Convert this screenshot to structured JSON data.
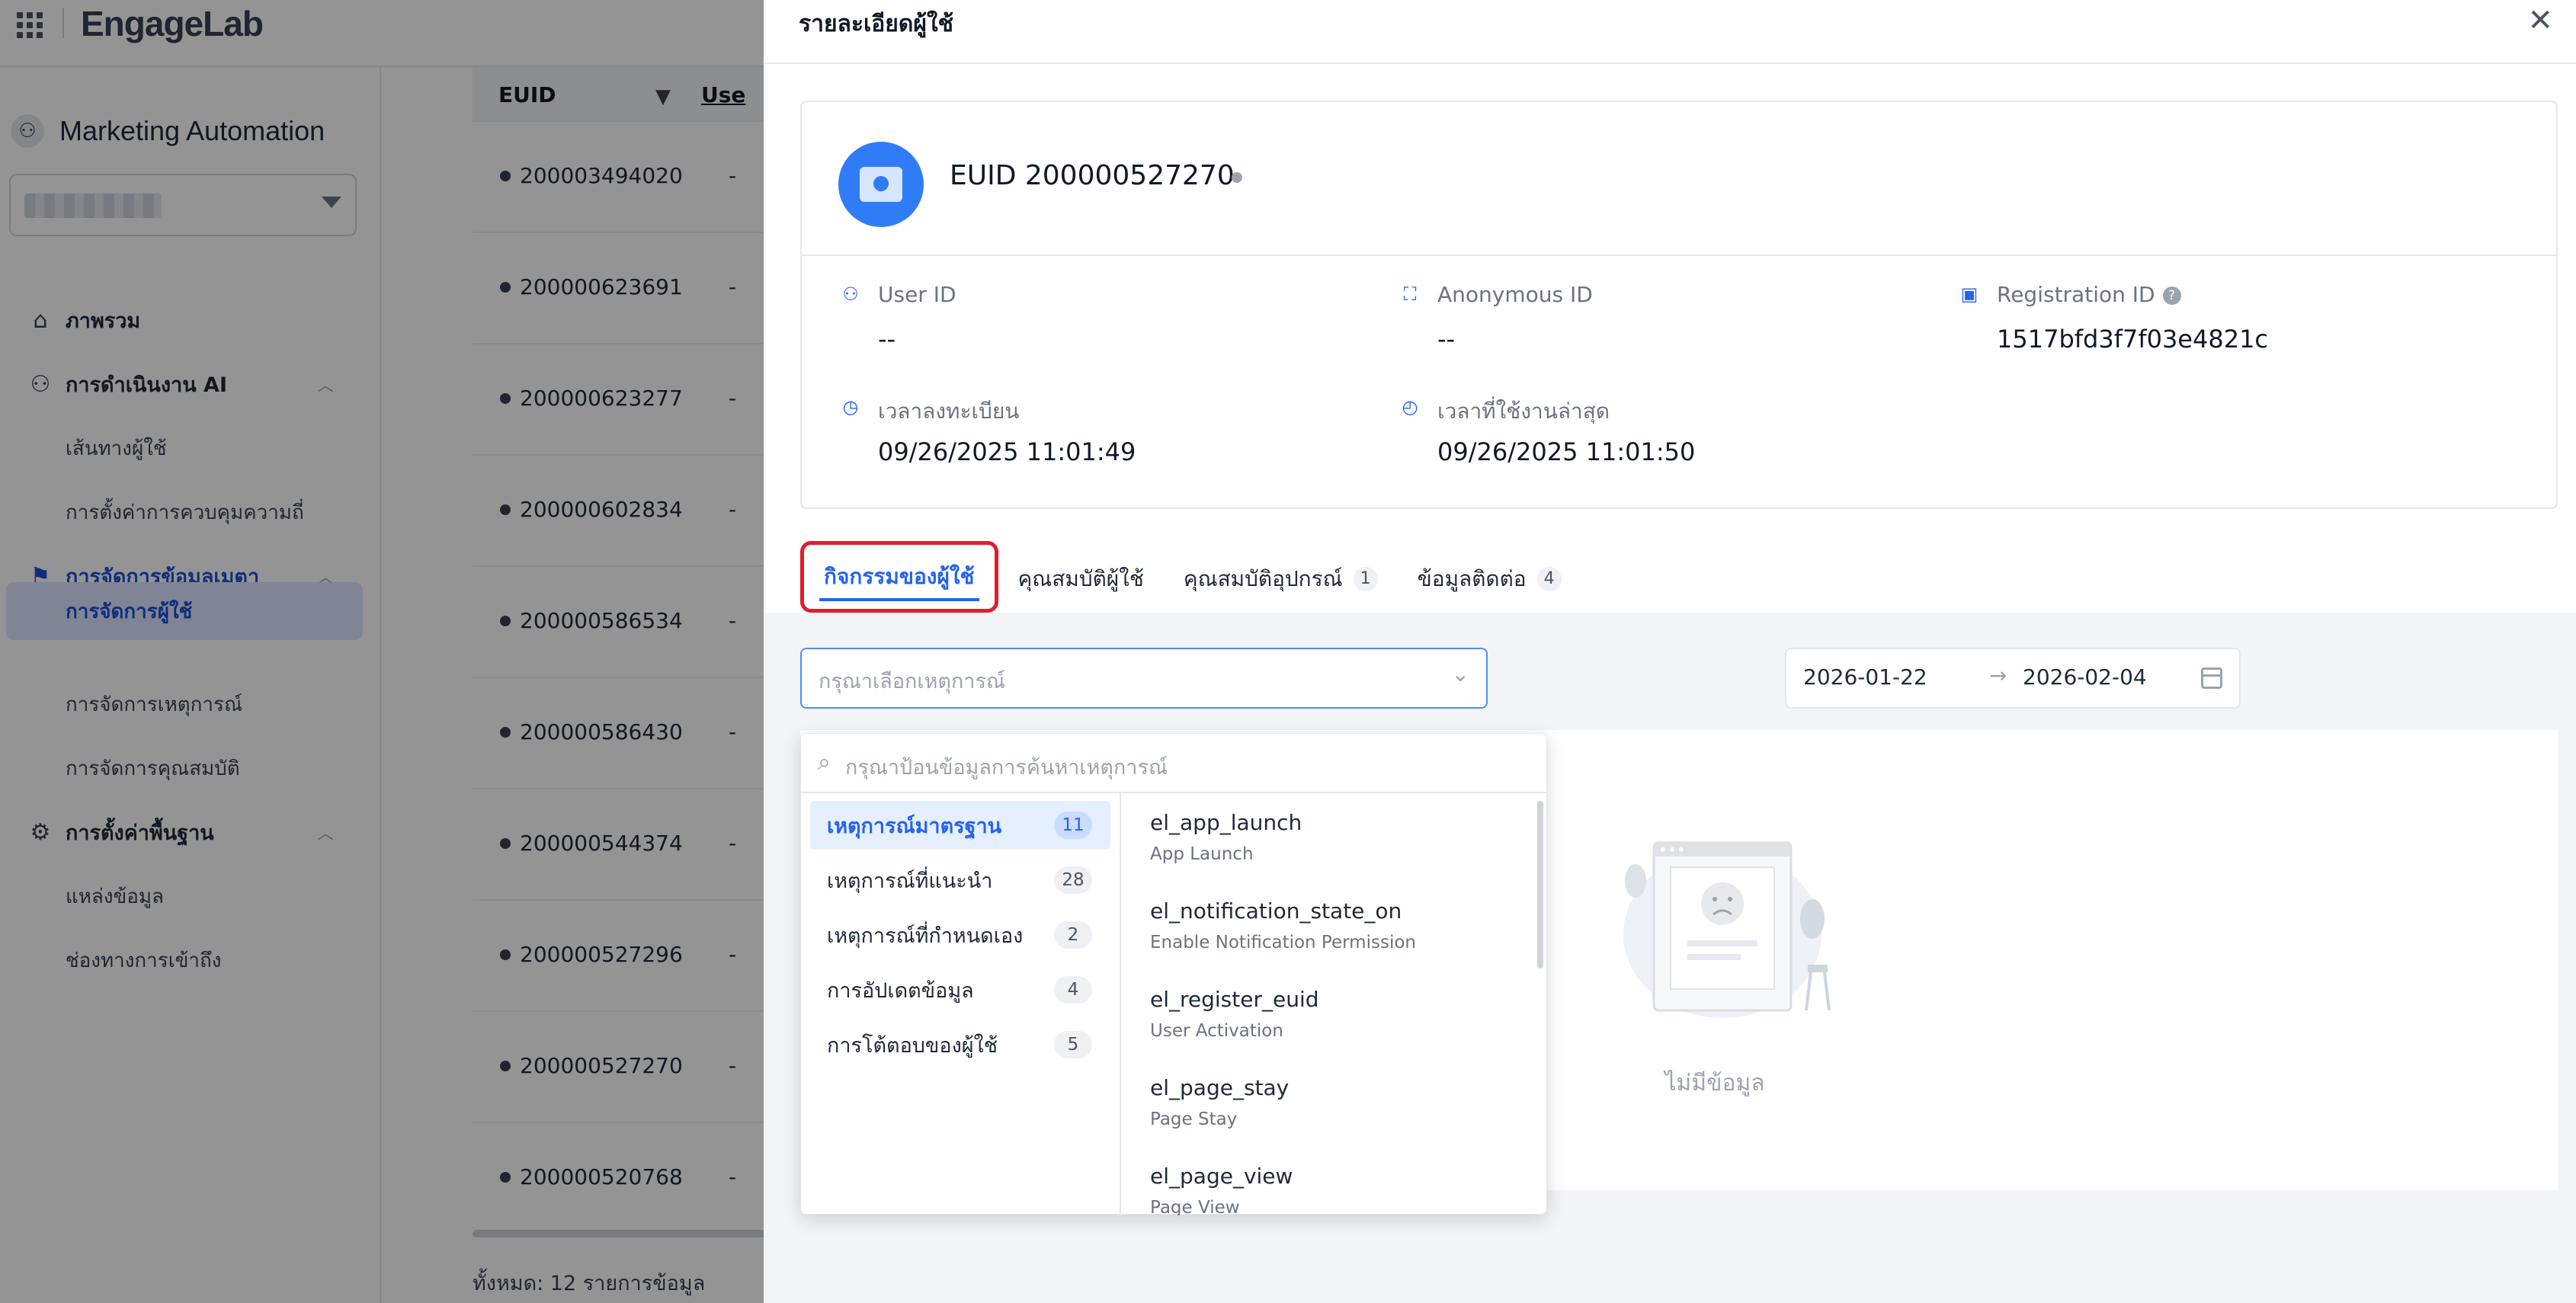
{
  "app": {
    "logo_text": "EngageLab",
    "product_name": "Marketing Automation"
  },
  "sidebar": {
    "items": [
      {
        "label": "ภาพรวม",
        "icon": "home-icon"
      },
      {
        "label": "การดำเนินงาน AI",
        "icon": "flow-icon"
      },
      {
        "label": "เส้นทางผู้ใช้"
      },
      {
        "label": "การตั้งค่าการควบคุมความถี่"
      },
      {
        "label": "การจัดการข้อมูลเมตา",
        "icon": "metadata-icon"
      },
      {
        "label": "การจัดการผู้ใช้"
      },
      {
        "label": "การจัดการเหตุการณ์"
      },
      {
        "label": "การจัดการคุณสมบัติ"
      },
      {
        "label": "การตั้งค่าพื้นฐาน",
        "icon": "settings-icon"
      },
      {
        "label": "แหล่งข้อมูล"
      },
      {
        "label": "ช่องทางการเข้าถึง"
      }
    ]
  },
  "user_list": {
    "columns": [
      "EUID",
      "Use"
    ],
    "rows": [
      {
        "euid": "200003494020",
        "user": "-"
      },
      {
        "euid": "200000623691",
        "user": "-"
      },
      {
        "euid": "200000623277",
        "user": "-"
      },
      {
        "euid": "200000602834",
        "user": "-"
      },
      {
        "euid": "200000586534",
        "user": "-"
      },
      {
        "euid": "200000586430",
        "user": "-"
      },
      {
        "euid": "200000544374",
        "user": "-"
      },
      {
        "euid": "200000527296",
        "user": "-"
      },
      {
        "euid": "200000527270",
        "user": "-"
      },
      {
        "euid": "200000520768",
        "user": "-"
      }
    ],
    "total_text": "ทั้งหมด: 12 รายการข้อมูล"
  },
  "drawer": {
    "title": "รายละเอียดผู้ใช้",
    "close_icon": "close-icon",
    "profile": {
      "euid_title": "EUID 200000527270",
      "fields": {
        "user_id": {
          "label": "User ID",
          "value": "--"
        },
        "anonymous_id": {
          "label": "Anonymous ID",
          "value": "--"
        },
        "registration_id": {
          "label": "Registration ID",
          "value": "1517bfd3f7f03e4821c"
        },
        "registered_time": {
          "label": "เวลาลงทะเบียน",
          "value": "09/26/2025 11:01:49"
        },
        "last_active_time": {
          "label": "เวลาที่ใช้งานล่าสุด",
          "value": "09/26/2025 11:01:50"
        }
      }
    },
    "tabs": [
      {
        "label": "กิจกรรมของผู้ใช้",
        "badge": ""
      },
      {
        "label": "คุณสมบัติผู้ใช้",
        "badge": ""
      },
      {
        "label": "คุณสมบัติอุปกรณ์",
        "badge": "1"
      },
      {
        "label": "ข้อมูลติดต่อ",
        "badge": "4"
      }
    ],
    "event_select_placeholder": "กรุณาเลือกเหตุการณ์",
    "date_range": {
      "start": "2026-01-22",
      "arrow": "→",
      "end": "2026-02-04"
    },
    "empty_text": "ไม่มีข้อมูล"
  },
  "event_dropdown": {
    "search_placeholder": "กรุณาป้อนข้อมูลการค้นหาเหตุการณ์",
    "categories": [
      {
        "label": "เหตุการณ์มาตรฐาน",
        "count": "11"
      },
      {
        "label": "เหตุการณ์ที่แนะนำ",
        "count": "28"
      },
      {
        "label": "เหตุการณ์ที่กำหนดเอง",
        "count": "2"
      },
      {
        "label": "การอัปเดตข้อมูล",
        "count": "4"
      },
      {
        "label": "การโต้ตอบของผู้ใช้",
        "count": "5"
      }
    ],
    "events": [
      {
        "name": "el_app_launch",
        "desc": "App Launch"
      },
      {
        "name": "el_notification_state_on",
        "desc": "Enable Notification Permission"
      },
      {
        "name": "el_register_euid",
        "desc": "User Activation"
      },
      {
        "name": "el_page_stay",
        "desc": "Page Stay"
      },
      {
        "name": "el_page_view",
        "desc": "Page View"
      }
    ]
  },
  "colors": {
    "accent": "#2563eb",
    "highlight_border": "#e11d2e",
    "avatar": "#2f7cf6"
  }
}
